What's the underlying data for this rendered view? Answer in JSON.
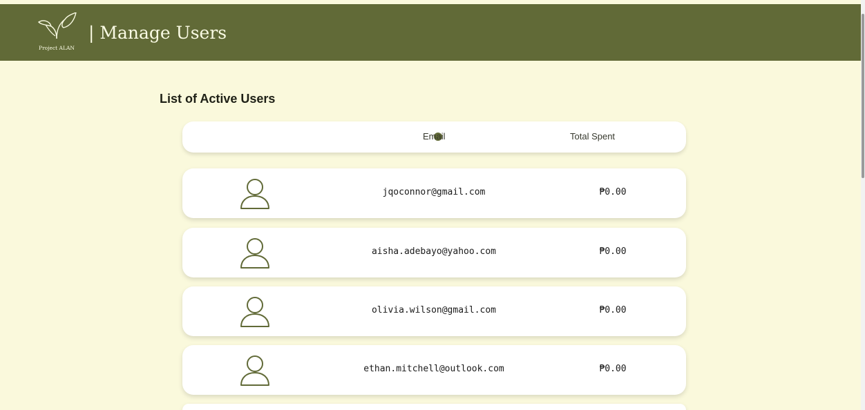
{
  "header": {
    "logo_text": "Project ALAN",
    "title": "| Manage Users",
    "bar_color": "#616a37"
  },
  "main": {
    "section_title": "List of Active Users",
    "columns": {
      "avatar_indicator": "dot",
      "email": "Email",
      "total_spent": "Total Spent"
    },
    "users": [
      {
        "email": "jqoconnor@gmail.com",
        "total_spent": "₱0.00"
      },
      {
        "email": "aisha.adebayo@yahoo.com",
        "total_spent": "₱0.00"
      },
      {
        "email": "olivia.wilson@gmail.com",
        "total_spent": "₱0.00"
      },
      {
        "email": "ethan.mitchell@outlook.com",
        "total_spent": "₱0.00"
      }
    ]
  },
  "icons": [
    "sprout-logo-icon",
    "user-avatar-icon"
  ],
  "colors": {
    "accent": "#616a37",
    "background": "#faf9dc",
    "card": "#ffffff"
  }
}
